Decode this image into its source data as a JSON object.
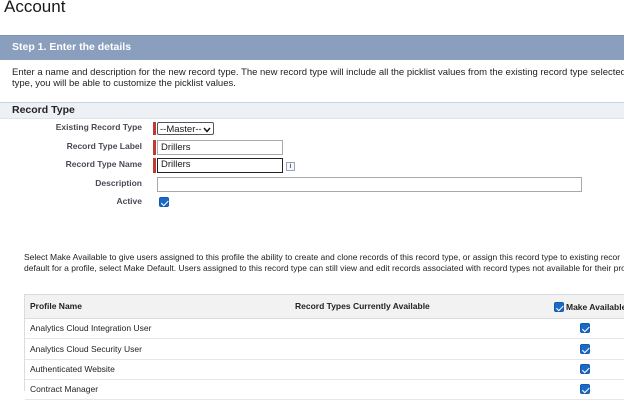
{
  "page": {
    "title": "Account"
  },
  "step": {
    "title": "Step 1. Enter the details"
  },
  "intro": {
    "line1": "Enter a name and description for the new record type. The new record type will include all the picklist values from the existing record type selected be",
    "line2": "type, you will be able to customize the picklist values."
  },
  "section": {
    "title": "Record Type"
  },
  "form": {
    "existing_label": "Existing Record Type",
    "existing_value": "--Master--",
    "label_label": "Record Type Label",
    "label_value": "Drillers",
    "name_label": "Record Type Name",
    "name_value": "Drillers",
    "description_label": "Description",
    "description_value": "",
    "active_label": "Active",
    "active_checked": true,
    "info_glyph": "i"
  },
  "availability": {
    "line1": "Select Make Available to give users assigned to this profile the ability to create and clone records of this record type, or assign this record type to existing recor",
    "line2": "default for a profile, select Make Default. Users assigned to this record type can still view and edit records associated with record types not available for their pro"
  },
  "table": {
    "headers": {
      "profile": "Profile Name",
      "available": "Record Types Currently Available",
      "make_available": "Make Available"
    },
    "rows": [
      {
        "profile": "Analytics Cloud Integration User",
        "available": "",
        "checked": true
      },
      {
        "profile": "Analytics Cloud Security User",
        "available": "",
        "checked": true
      },
      {
        "profile": "Authenticated Website",
        "available": "",
        "checked": true
      },
      {
        "profile": "Contract Manager",
        "available": "",
        "checked": true
      }
    ]
  },
  "colors": {
    "step_bar": "#8a9ebe",
    "required": "#c23934",
    "checkbox": "#1b6ac9"
  }
}
